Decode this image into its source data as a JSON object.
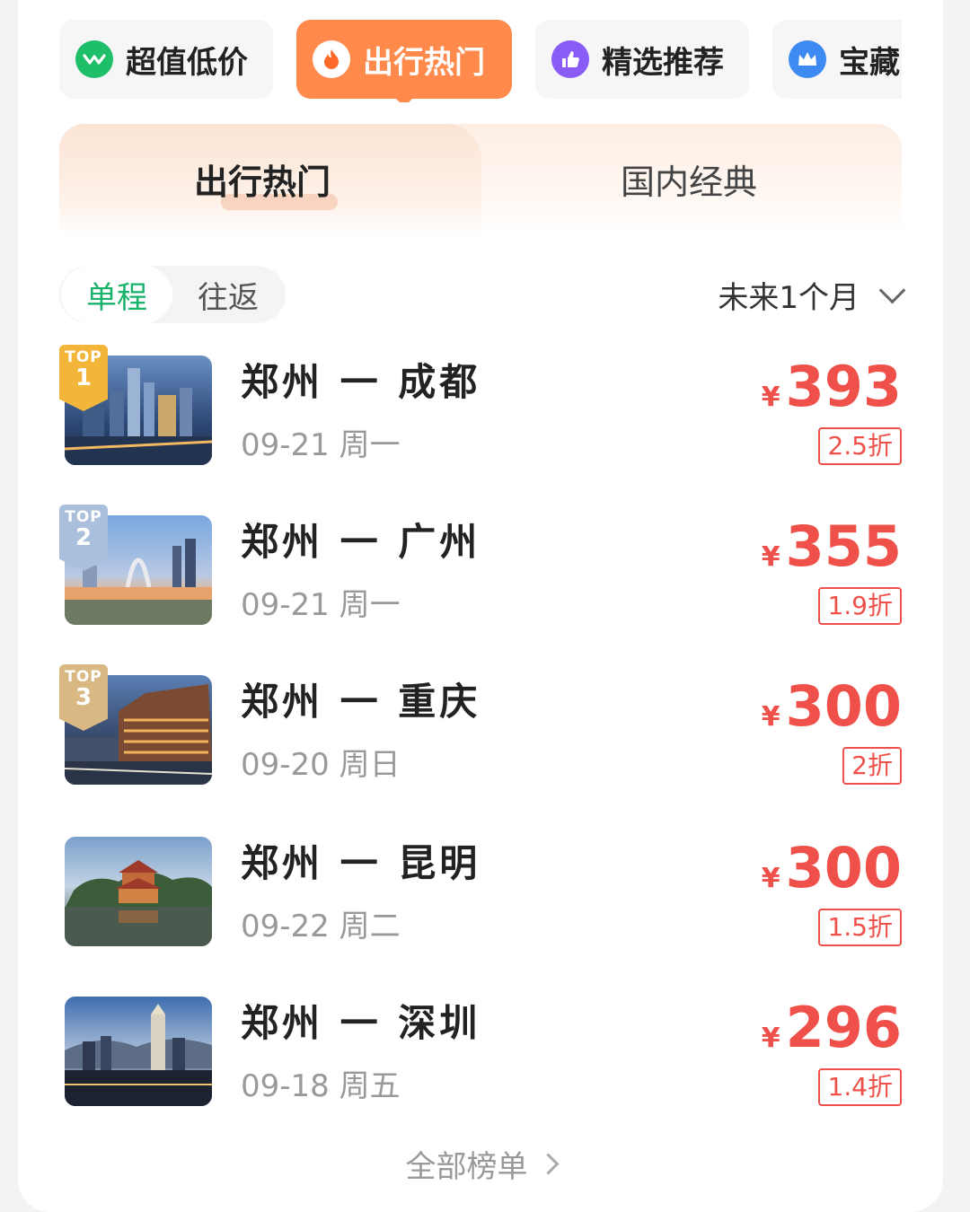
{
  "categories": [
    {
      "label": "超值低价",
      "icon": "graph-icon",
      "color": "#1fbf6a",
      "active": false
    },
    {
      "label": "出行热门",
      "icon": "fire-icon",
      "color": "#ffffff",
      "active": true
    },
    {
      "label": "精选推荐",
      "icon": "thumb-up-icon",
      "color": "#8a5cf6",
      "active": false
    },
    {
      "label": "宝藏",
      "icon": "crown-icon",
      "color": "#3d8bf2",
      "active": false
    }
  ],
  "subtabs": {
    "left": "出行热门",
    "right": "国内经典"
  },
  "trip_type": {
    "one_way": "单程",
    "round_trip": "往返"
  },
  "range": {
    "label": "未来1个月"
  },
  "routes": [
    {
      "rank_label": "TOP",
      "rank": "1",
      "title": "郑州 一 成都",
      "date": "09-21 周一",
      "currency": "¥",
      "price": "393",
      "discount": "2.5折"
    },
    {
      "rank_label": "TOP",
      "rank": "2",
      "title": "郑州 一 广州",
      "date": "09-21 周一",
      "currency": "¥",
      "price": "355",
      "discount": "1.9折"
    },
    {
      "rank_label": "TOP",
      "rank": "3",
      "title": "郑州 一 重庆",
      "date": "09-20 周日",
      "currency": "¥",
      "price": "300",
      "discount": "2折"
    },
    {
      "title": "郑州 一 昆明",
      "date": "09-22 周二",
      "currency": "¥",
      "price": "300",
      "discount": "1.5折"
    },
    {
      "title": "郑州 一 深圳",
      "date": "09-18 周五",
      "currency": "¥",
      "price": "296",
      "discount": "1.4折"
    }
  ],
  "footer": {
    "all_label": "全部榜单"
  },
  "colors": {
    "accent_green": "#19b26b",
    "active_orange": "#ff8a4c",
    "price_red": "#f0504a"
  }
}
